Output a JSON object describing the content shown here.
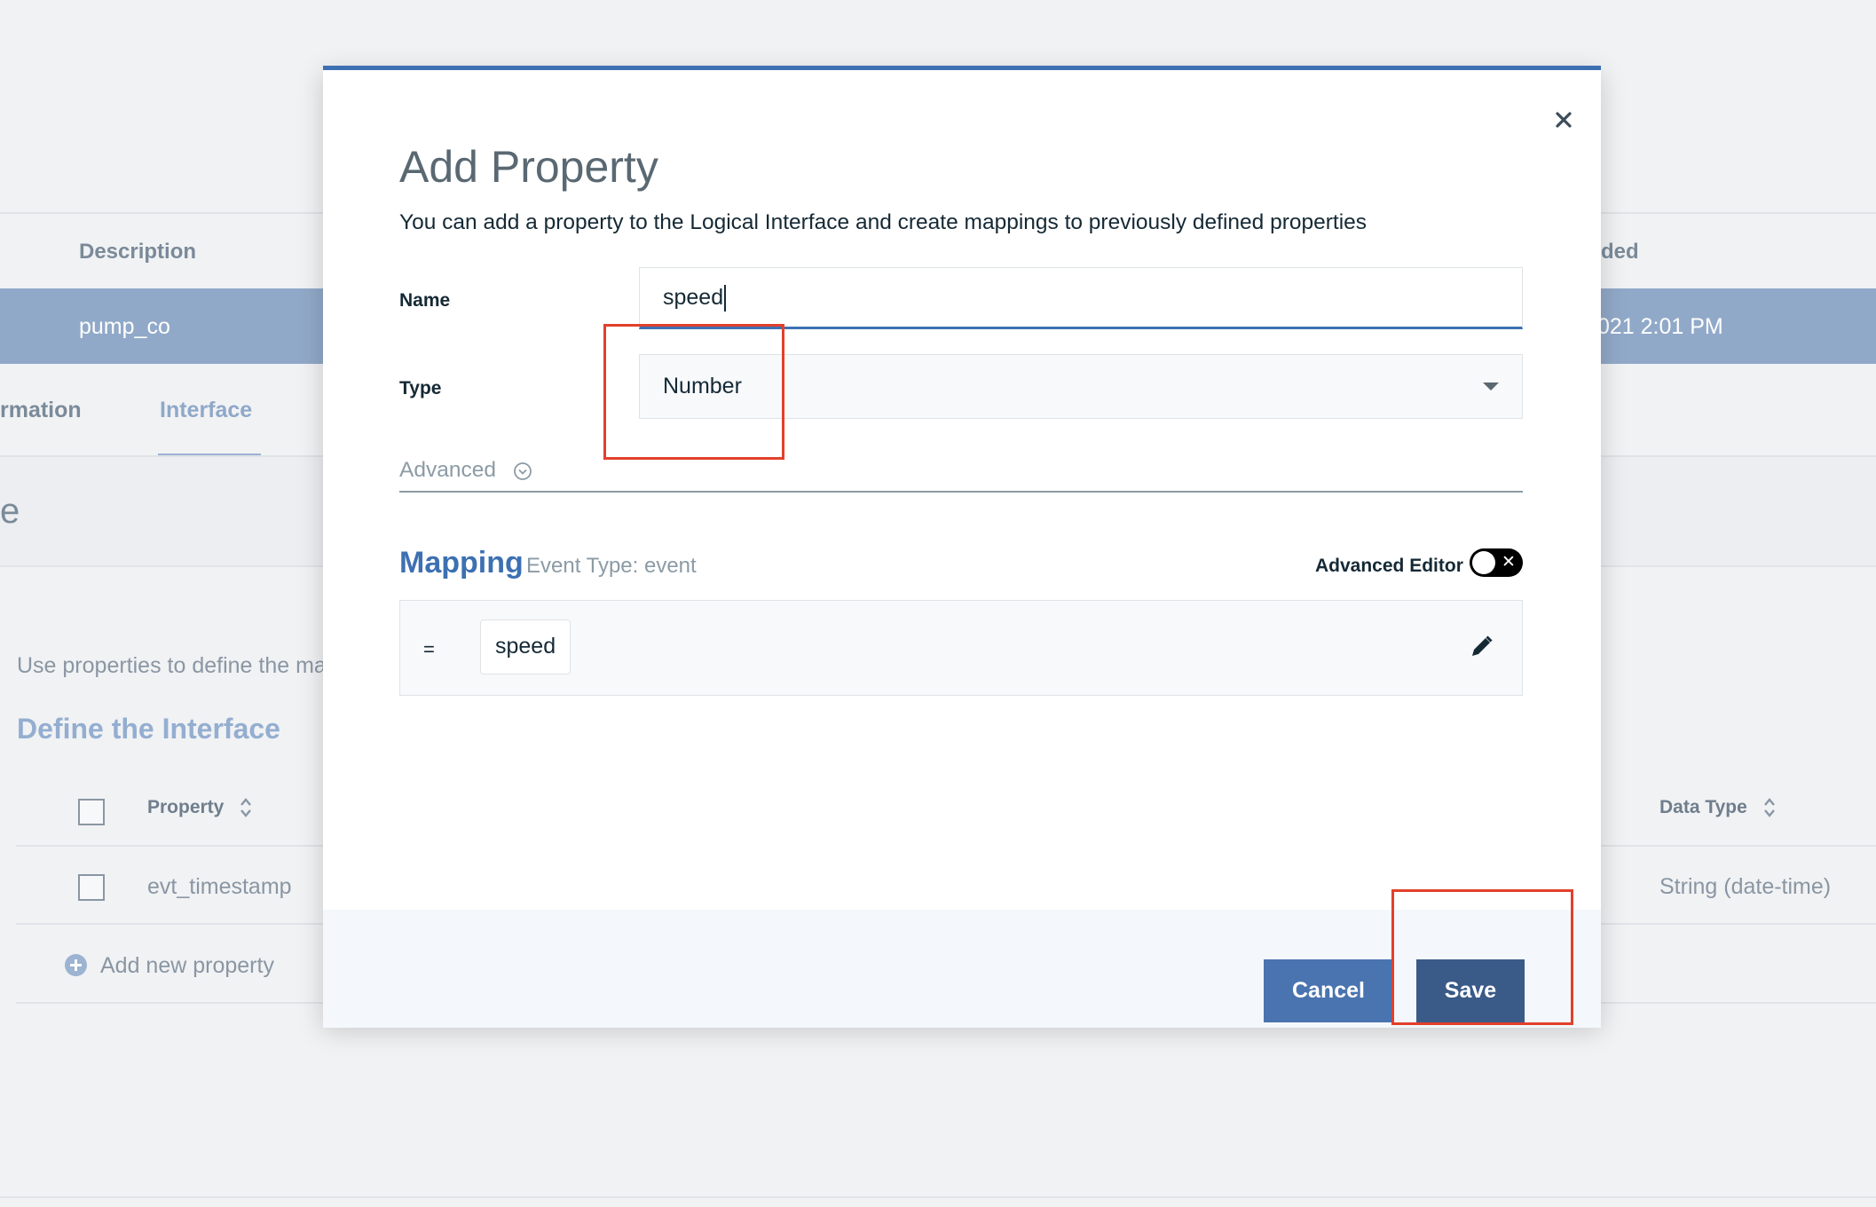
{
  "background": {
    "table_headers": {
      "description": "Description",
      "added": "ded"
    },
    "selected_row": {
      "description": "pump_co",
      "date": "021 2:01 PM"
    },
    "tabs": [
      {
        "label": "rmation"
      },
      {
        "label": "Interface"
      }
    ],
    "section_title_fragment": "e",
    "help_text": "Use properties to define the ma",
    "define_title": "Define the Interface",
    "properties_table": {
      "headers": {
        "property": "Property",
        "data_type": "Data Type"
      },
      "rows": [
        {
          "property": "evt_timestamp",
          "data_type": "String (date-time)"
        }
      ],
      "add_label": "Add new property"
    }
  },
  "modal": {
    "title": "Add Property",
    "subtitle": "You can add a property to the Logical Interface and create mappings to previously defined properties",
    "name_label": "Name",
    "name_value": "speed",
    "type_label": "Type",
    "type_value": "Number",
    "advanced_label": "Advanced",
    "mapping_title": "Mapping",
    "event_type": "Event Type: event",
    "advanced_editor_label": "Advanced Editor",
    "advanced_editor_on": false,
    "toggle_glyph": "✕",
    "mapping_operator": "=",
    "mapping_value": "speed",
    "cancel_label": "Cancel",
    "save_label": "Save",
    "close_glyph": "✕"
  },
  "colors": {
    "accent": "#3d70b2",
    "highlight": "#e2402b",
    "save_button": "#3a5a88",
    "cancel_button": "#4a74b0"
  }
}
